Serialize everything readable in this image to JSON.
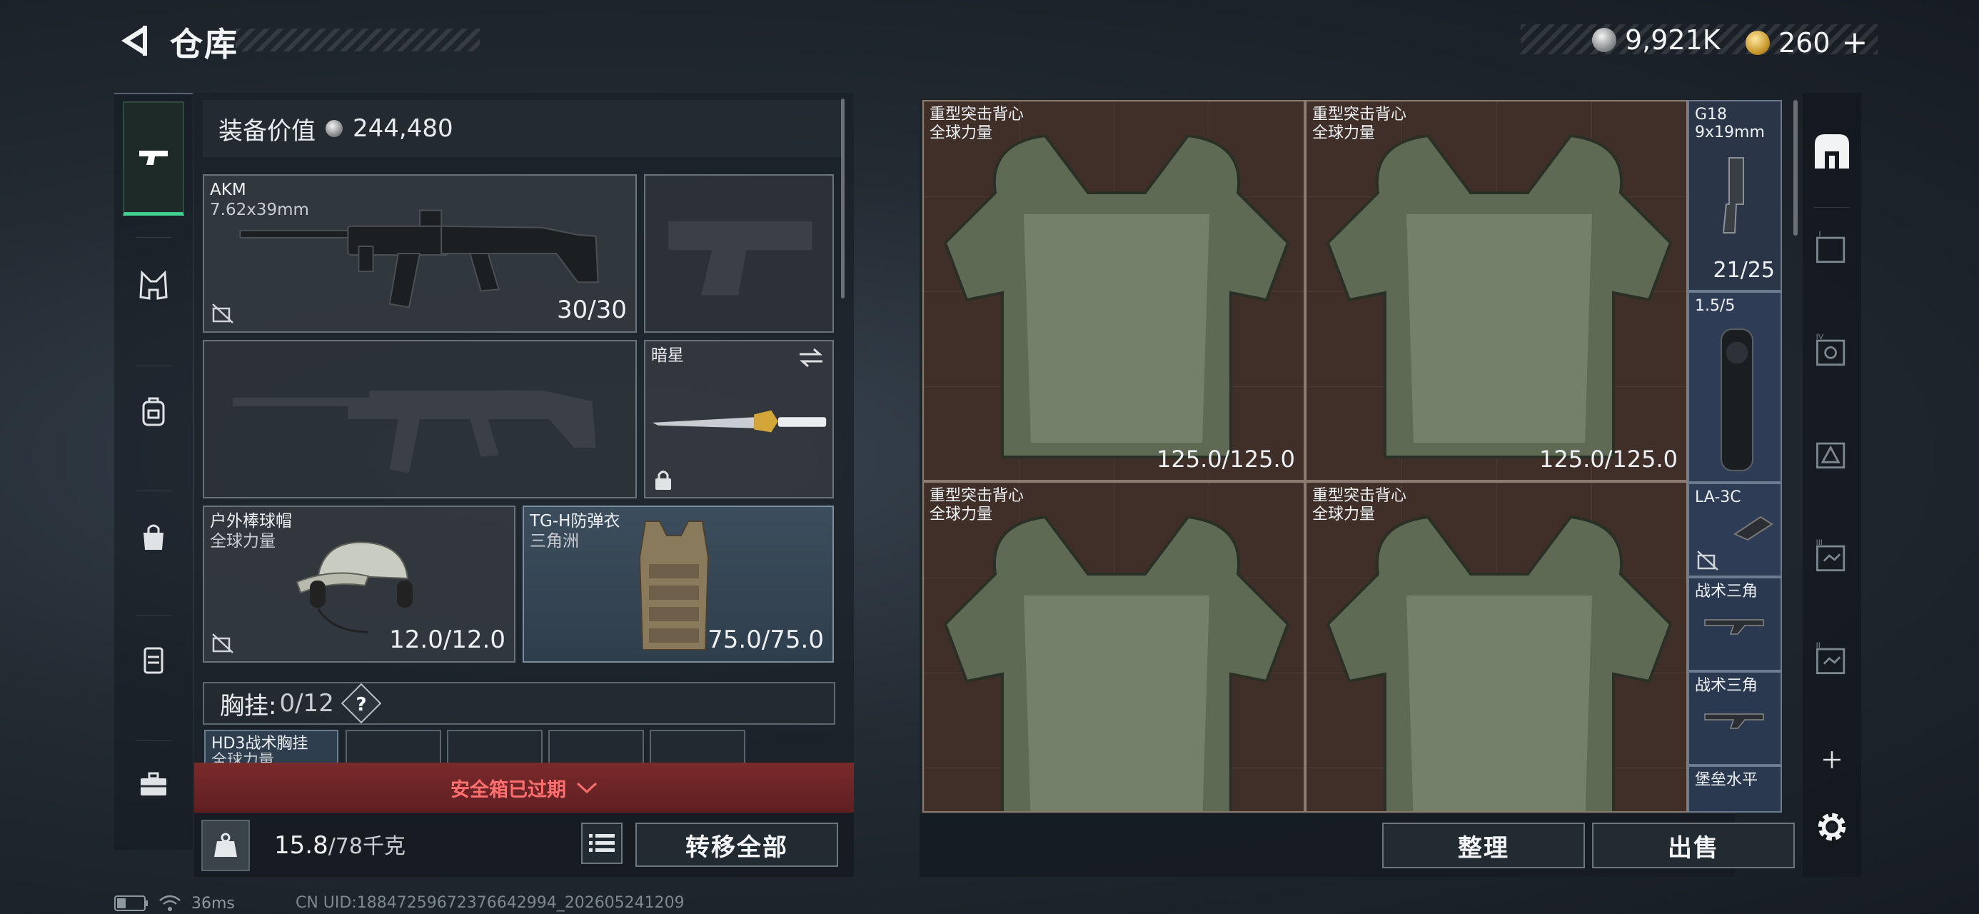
{
  "header": {
    "title": "仓库",
    "currency_silver": "9,921K",
    "currency_gold": "260",
    "add_symbol": "+"
  },
  "loadout": {
    "equipment_value_label": "装备价值",
    "equipment_value": "244,480",
    "primary_weapon": {
      "name": "AKM",
      "caliber": "7.62x39mm",
      "ammo": "30/30"
    },
    "melee": {
      "name": "暗星"
    },
    "helmet": {
      "name": "户外棒球帽",
      "faction": "全球力量",
      "durability": "12.0/12.0"
    },
    "armor": {
      "name": "TG-H防弹衣",
      "faction": "三角洲",
      "durability": "75.0/75.0"
    },
    "chest_rig_label": "胸挂:",
    "chest_rig_count": "0/12",
    "help": "?",
    "chest_item": {
      "name": "HD3战术胸挂",
      "faction": "全球力量"
    }
  },
  "safe_box_banner": "安全箱已过期",
  "weight": {
    "current": "15.8",
    "max": "/78千克"
  },
  "buttons": {
    "transfer_all": "转移全部",
    "sort": "整理",
    "sell": "出售"
  },
  "stash": {
    "vests": [
      {
        "name": "重型突击背心",
        "faction": "全球力量",
        "durability": "125.0/125.0"
      },
      {
        "name": "重型突击背心",
        "faction": "全球力量",
        "durability": "125.0/125.0"
      },
      {
        "name": "重型突击背心",
        "faction": "全球力量",
        "durability": ""
      },
      {
        "name": "重型突击背心",
        "faction": "全球力量",
        "durability": ""
      }
    ],
    "side_items": [
      {
        "name": "G18",
        "sub": "9x19mm",
        "count": "21/25"
      },
      {
        "name": "1.5/5",
        "sub": "",
        "count": ""
      },
      {
        "name": "LA-3C",
        "sub": "",
        "count": ""
      },
      {
        "name": "战术三角",
        "sub": "",
        "count": ""
      },
      {
        "name": "战术三角",
        "sub": "",
        "count": ""
      },
      {
        "name": "堡垒水平",
        "sub": "",
        "count": ""
      }
    ]
  },
  "right_rail": {
    "roman_1": "I",
    "roman_2": "II",
    "roman_3": "III",
    "roman_4": "IV"
  },
  "status": {
    "ping": "36ms",
    "uid": "CN UID:18847259672376642994_202605241209"
  }
}
